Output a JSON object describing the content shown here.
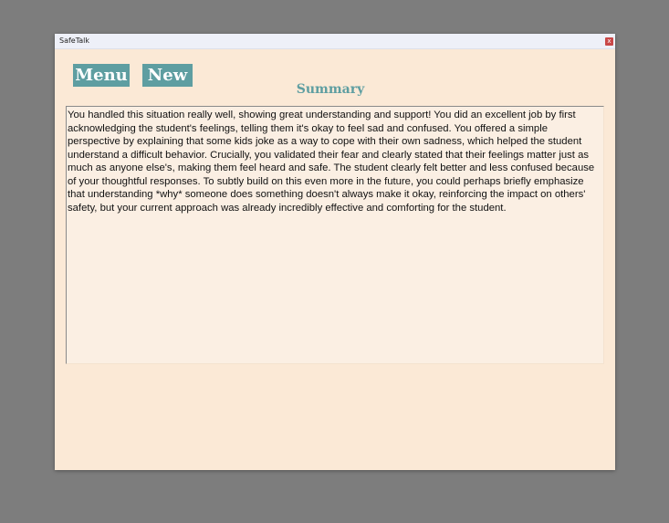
{
  "window": {
    "title": "SafeTalk",
    "close_label": "x"
  },
  "toolbar": {
    "menu_label": "Menu",
    "new_label": "New"
  },
  "page": {
    "title": "Summary"
  },
  "summary": {
    "text": "You handled this situation really well, showing great understanding and support! You did an excellent job by first acknowledging the student's feelings, telling them it's okay to feel sad and confused. You offered a simple perspective by explaining that some kids joke as a way to cope with their own sadness, which helped the student understand a difficult behavior. Crucially, you validated their fear and clearly stated that their feelings matter just as much as anyone else's, making them feel heard and safe. The student clearly felt better and less confused because of your thoughtful responses. To subtly build on this even more in the future, you could perhaps briefly emphasize that understanding *why* someone does something doesn't always make it okay, reinforcing the impact on others' safety, but your current approach was already incredibly effective and comforting for the student."
  },
  "colors": {
    "accent": "#5e9ea1",
    "window_background": "#fbe9d6",
    "close_button": "#c94848"
  }
}
